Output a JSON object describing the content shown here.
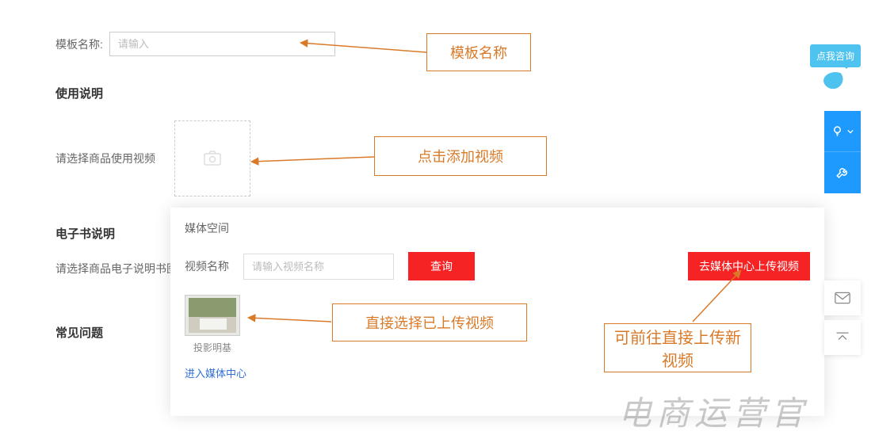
{
  "form": {
    "template_name_label": "模板名称:",
    "template_name_placeholder": "请输入",
    "usage_section_title": "使用说明",
    "video_select_label": "请选择商品使用视频",
    "ebook_section_title": "电子书说明",
    "ebook_select_label": "请选择商品电子说明书图片",
    "faq_section_title": "常见问题"
  },
  "media": {
    "panel_title": "媒体空间",
    "video_name_label": "视频名称",
    "video_name_placeholder": "请输入视频名称",
    "search_btn": "查询",
    "upload_btn": "去媒体中心上传视频",
    "video_item_label": "投影明基",
    "media_center_link": "进入媒体中心"
  },
  "annotations": {
    "template_name": "模板名称",
    "add_video": "点击添加视频",
    "select_uploaded": "直接选择已上传视频",
    "go_upload": "可前往直接上传新视频"
  },
  "widgets": {
    "consult_text": "点我咨询"
  },
  "watermark": "电商运营官"
}
